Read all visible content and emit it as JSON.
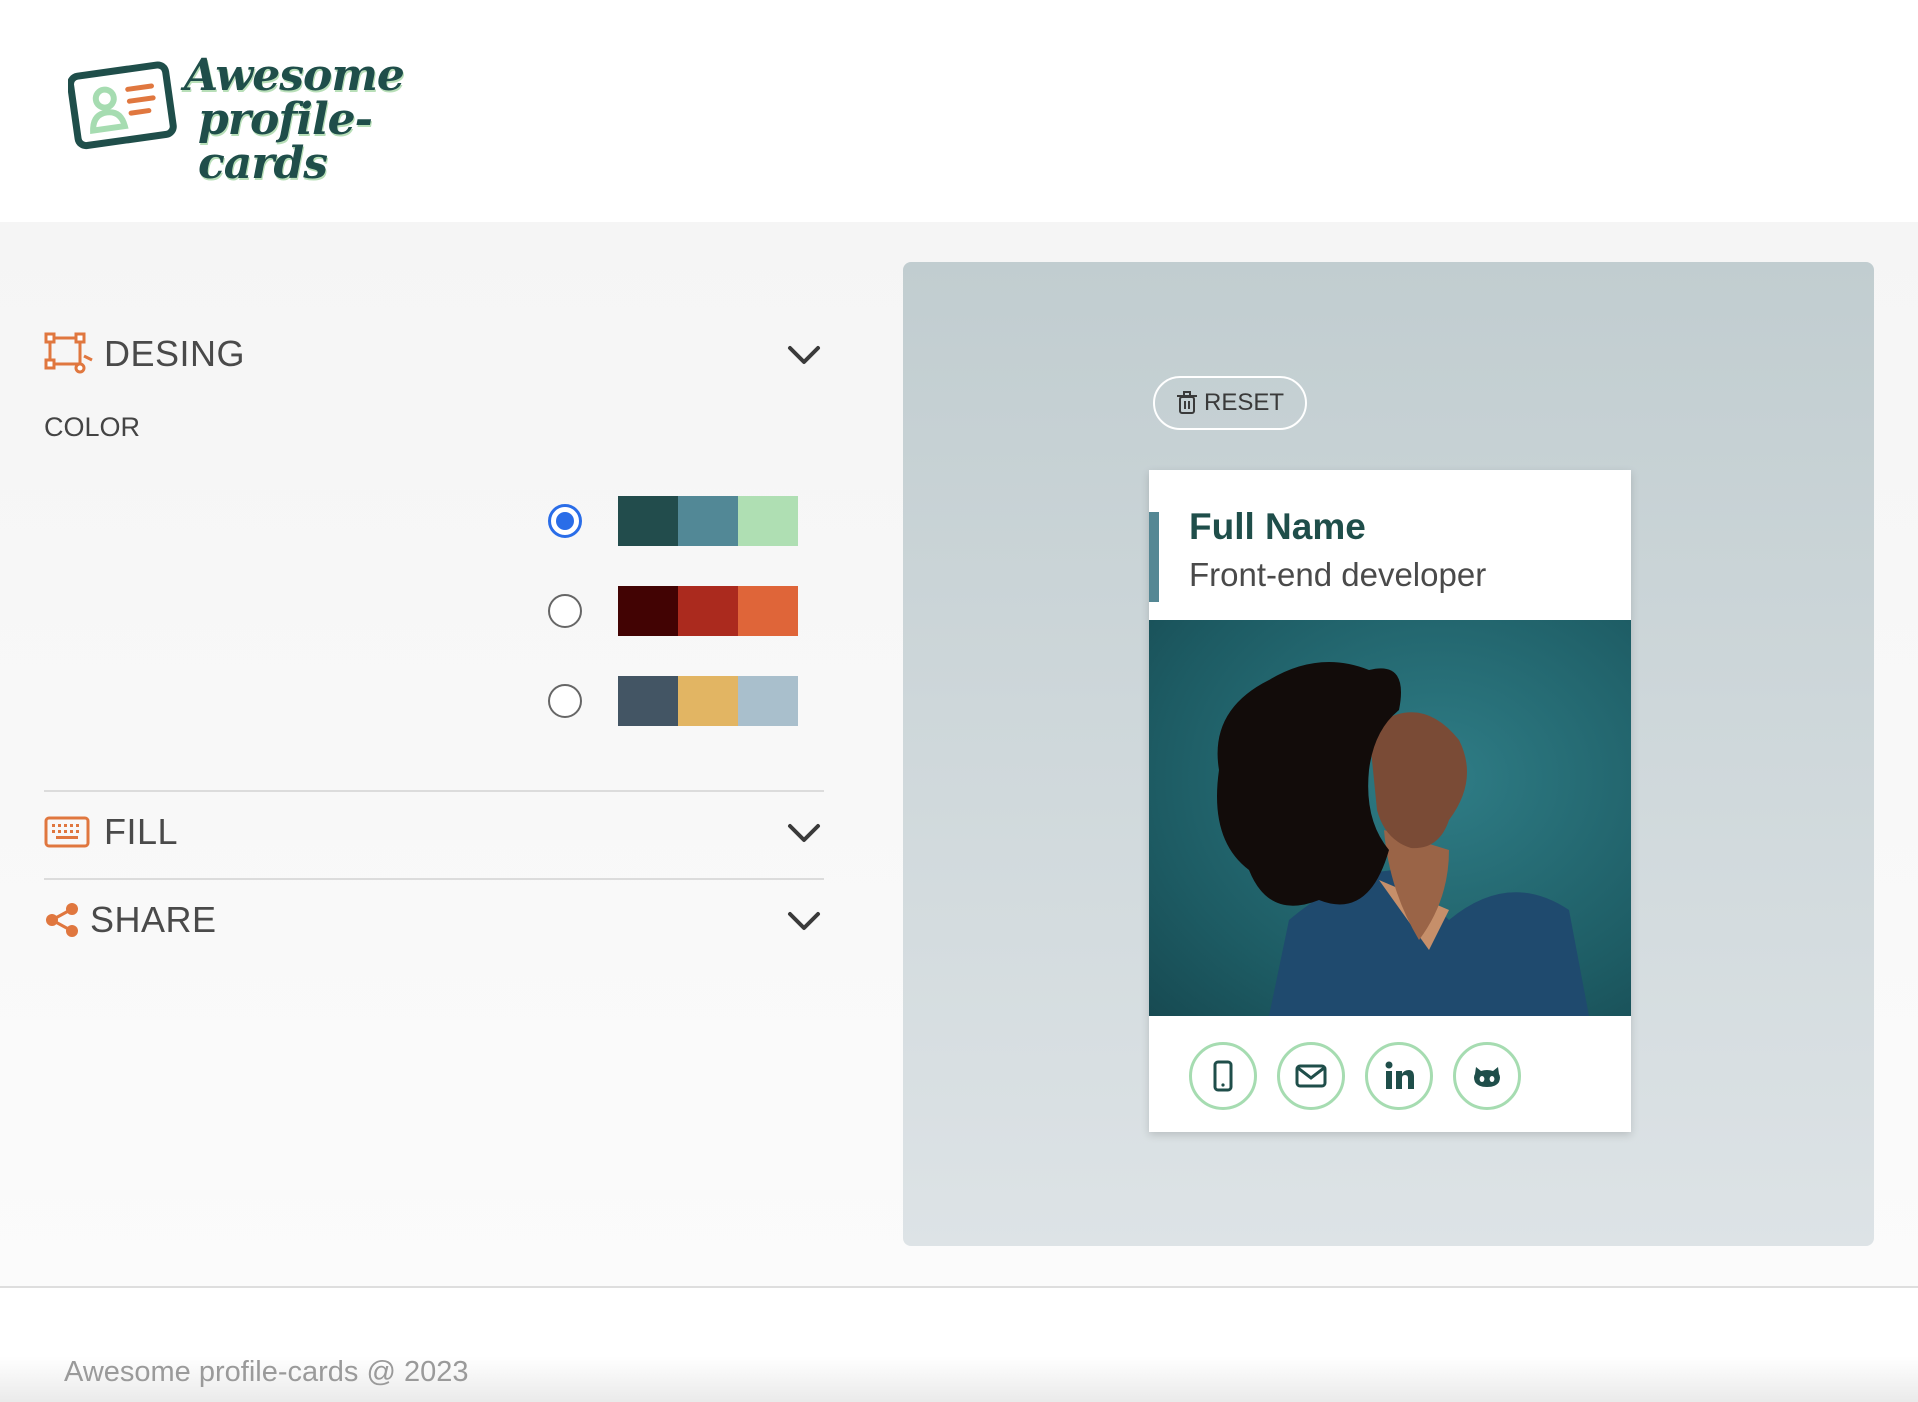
{
  "logo": {
    "line1": "Awesome",
    "line2": "profile-cards"
  },
  "sections": {
    "design": {
      "title": "DESING",
      "color_label": "COLOR"
    },
    "fill": {
      "title": "FILL"
    },
    "share": {
      "title": "SHARE"
    }
  },
  "palettes": [
    {
      "selected": true,
      "colors": [
        "#224c4c",
        "#528896",
        "#afdfb3"
      ]
    },
    {
      "selected": false,
      "colors": [
        "#420303",
        "#ab2a1e",
        "#df6539"
      ]
    },
    {
      "selected": false,
      "colors": [
        "#435564",
        "#e2b563",
        "#a9bfcc"
      ]
    }
  ],
  "preview": {
    "reset_label": "RESET",
    "card": {
      "name": "Full Name",
      "job": "Front-end developer",
      "social_icons": [
        "mobile-icon",
        "email-icon",
        "linkedin-icon",
        "github-icon"
      ]
    }
  },
  "footer": {
    "text": "Awesome profile-cards @ 2023"
  },
  "colors": {
    "accent_orange": "#e0773f",
    "primary_dark": "#1f4e4a",
    "social_border": "#a6dcb1"
  }
}
